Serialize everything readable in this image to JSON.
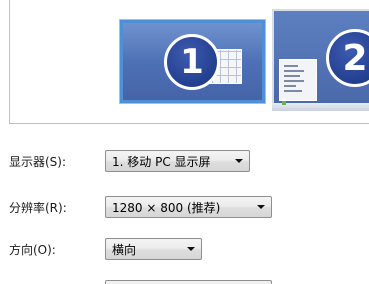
{
  "preview": {
    "monitor_1_number": "1",
    "monitor_2_number": "2",
    "selected_monitor": "1",
    "monitor_fill_color": "#4d6fb4",
    "selected_border_color": "#4f8fd6"
  },
  "settings": {
    "display": {
      "label": "显示器(S):",
      "value": "1. 移动 PC 显示屏"
    },
    "resolution": {
      "label": "分辨率(R):",
      "value": "1280 × 800 (推荐)"
    },
    "orientation": {
      "label": "方向(O):",
      "value": "横向"
    }
  }
}
